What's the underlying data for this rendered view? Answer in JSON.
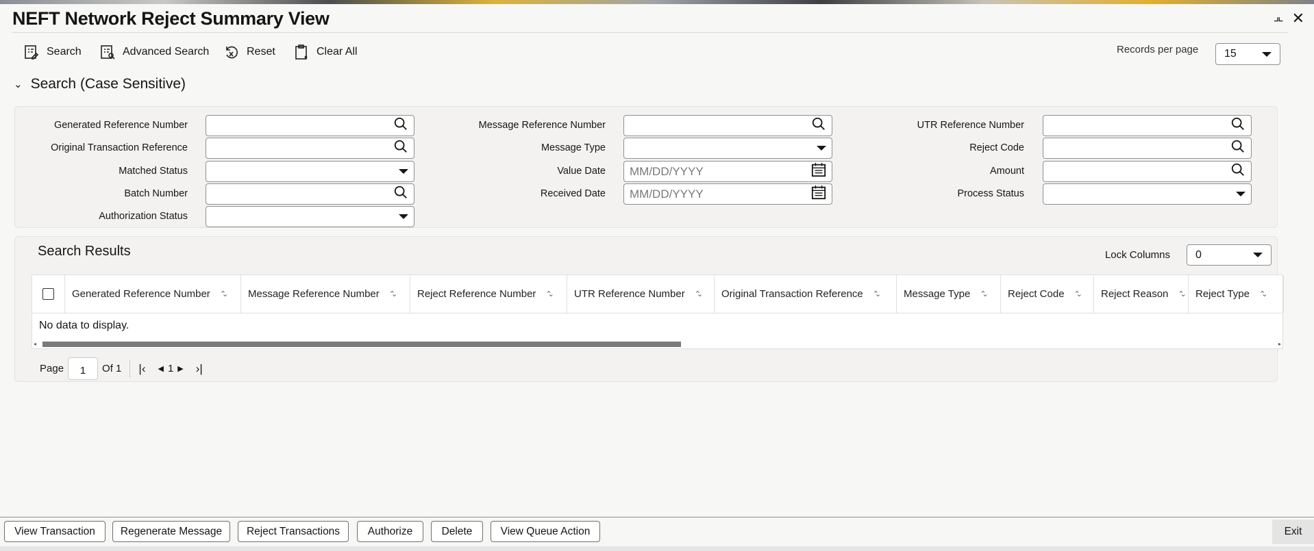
{
  "window": {
    "title": "NEFT Network Reject Summary View"
  },
  "toolbar": {
    "search": "Search",
    "advanced_search": "Advanced Search",
    "reset": "Reset",
    "clear_all": "Clear All"
  },
  "records_per_page": {
    "label": "Records per page",
    "value": "15"
  },
  "search_section": {
    "title": "Search (Case Sensitive)"
  },
  "fields": [
    {
      "label": "Generated Reference Number",
      "type": "lookup",
      "value": "",
      "placeholder": ""
    },
    {
      "label": "Original Transaction Reference",
      "type": "lookup",
      "value": "",
      "placeholder": ""
    },
    {
      "label": "Matched Status",
      "type": "select",
      "value": "",
      "placeholder": ""
    },
    {
      "label": "Batch Number",
      "type": "lookup",
      "value": "",
      "placeholder": ""
    },
    {
      "label": "Authorization Status",
      "type": "select",
      "value": "",
      "placeholder": ""
    },
    {
      "label": "Message Reference Number",
      "type": "lookup",
      "value": "",
      "placeholder": ""
    },
    {
      "label": "Message Type",
      "type": "select",
      "value": "",
      "placeholder": ""
    },
    {
      "label": "Value Date",
      "type": "date",
      "value": "",
      "placeholder": "MM/DD/YYYY"
    },
    {
      "label": "Received Date",
      "type": "date",
      "value": "",
      "placeholder": "MM/DD/YYYY"
    },
    {
      "label": "UTR Reference Number",
      "type": "lookup",
      "value": "",
      "placeholder": ""
    },
    {
      "label": "Reject Code",
      "type": "lookup",
      "value": "",
      "placeholder": ""
    },
    {
      "label": "Amount",
      "type": "lookup",
      "value": "",
      "placeholder": ""
    },
    {
      "label": "Process Status",
      "type": "select",
      "value": "",
      "placeholder": ""
    }
  ],
  "results": {
    "title": "Search Results",
    "lock_columns_label": "Lock Columns",
    "lock_columns_value": "0",
    "columns": [
      "Generated Reference Number",
      "Message Reference Number",
      "Reject Reference Number",
      "UTR Reference Number",
      "Original Transaction Reference",
      "Message Type",
      "Reject Code",
      "Reject Reason",
      "Reject Type"
    ],
    "empty_text": "No data to display."
  },
  "pagination": {
    "page_label": "Page",
    "page_value": "1",
    "of_label": "Of 1",
    "current": "1"
  },
  "footer": {
    "buttons": [
      "View Transaction",
      "Regenerate Message",
      "Reject Transactions",
      "Authorize",
      "Delete",
      "View Queue Action"
    ],
    "exit": "Exit"
  }
}
